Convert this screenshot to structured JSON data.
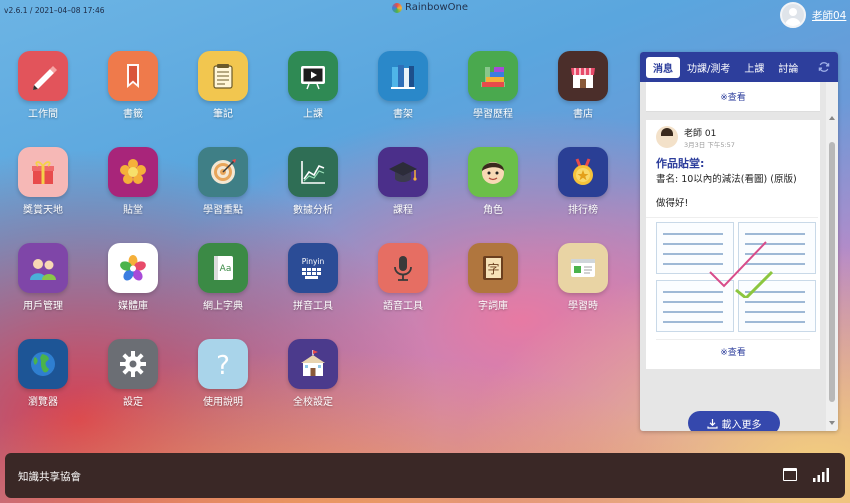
{
  "header": {
    "version": "v2.6.1 / 2021–04–08 17:46",
    "brand": "RainbowOne",
    "username": "老師04"
  },
  "apps": [
    {
      "label": "工作間",
      "icon": "pencil-icon",
      "color": "#e2545b"
    },
    {
      "label": "書籤",
      "icon": "bookmark-icon",
      "color": "#ef7a4b"
    },
    {
      "label": "筆記",
      "icon": "notepad-icon",
      "color": "#f2c64f"
    },
    {
      "label": "上課",
      "icon": "video-board-icon",
      "color": "#2f8a54"
    },
    {
      "label": "書架",
      "icon": "books-icon",
      "color": "#2a88c9"
    },
    {
      "label": "學習歷程",
      "icon": "stairs-icon",
      "color": "#4aa94e"
    },
    {
      "label": "書店",
      "icon": "shop-icon",
      "color": "#4b2e2a"
    },
    {
      "label": "獎賞天地",
      "icon": "gift-icon",
      "color": "#f6b8b6"
    },
    {
      "label": "貼堂",
      "icon": "flower-icon",
      "color": "#a8257a"
    },
    {
      "label": "學習重點",
      "icon": "target-icon",
      "color": "#3f7f86"
    },
    {
      "label": "數據分析",
      "icon": "line-chart-icon",
      "color": "#2f6e55"
    },
    {
      "label": "課程",
      "icon": "graduation-cap-icon",
      "color": "#4b2f8a"
    },
    {
      "label": "角色",
      "icon": "boy-face-icon",
      "color": "#6bbf49"
    },
    {
      "label": "排行榜",
      "icon": "medal-icon",
      "color": "#2a3f95"
    },
    {
      "label": "用戶管理",
      "icon": "users-icon",
      "color": "#7f46a8"
    },
    {
      "label": "媒體庫",
      "icon": "petals-icon",
      "color": "#ffffff"
    },
    {
      "label": "網上字典",
      "icon": "dictionary-icon",
      "color": "#3b8a45"
    },
    {
      "label": "拼音工具",
      "icon": "pinyin-keyboard-icon",
      "color": "#2b4c96"
    },
    {
      "label": "語音工具",
      "icon": "microphone-icon",
      "color": "#e66e63"
    },
    {
      "label": "字詞庫",
      "icon": "character-book-icon",
      "color": "#b0763e"
    },
    {
      "label": "學習時",
      "icon": "certificate-icon",
      "color": "#e9d4a4"
    },
    {
      "label": "瀏覽器",
      "icon": "globe-icon",
      "color": "#1d5596"
    },
    {
      "label": "設定",
      "icon": "gear-icon",
      "color": "#6b6e74"
    },
    {
      "label": "使用說明",
      "icon": "question-icon",
      "color": "#a9d4ea"
    },
    {
      "label": "全校設定",
      "icon": "school-icon",
      "color": "#4b3a8c"
    }
  ],
  "panel": {
    "tabs": [
      "消息",
      "功課/測考",
      "上課",
      "討論"
    ],
    "active_tab": "消息",
    "view_label": "※查看",
    "post": {
      "author": "老師 01",
      "time": "3月3日 下午5:57",
      "title": "作品貼堂:",
      "subtitle": "書名: 10以內的減法(看圖) (原版)",
      "body": "做得好!"
    },
    "load_more": "載入更多"
  },
  "dock": {
    "title": "知識共享協會"
  }
}
